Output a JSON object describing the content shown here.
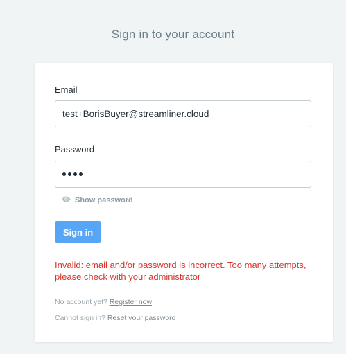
{
  "header": {
    "title": "Sign in to your account"
  },
  "form": {
    "email_label": "Email",
    "email_value": "test+BorisBuyer@streamliner.cloud",
    "password_label": "Password",
    "password_masked_length": 4,
    "show_password_label": "Show password",
    "show_password_icon": "eye-icon",
    "submit_label": "Sign in"
  },
  "error": {
    "message": "Invalid: email and/or password is incorrect. Too many attempts, please check with your administrator"
  },
  "footer": {
    "no_account_text": "No account yet?",
    "register_link": "Register now",
    "cannot_sign_in_text": "Cannot sign in?",
    "reset_link": "Reset your password"
  },
  "colors": {
    "accent": "#56a6f5",
    "error": "#d9352b",
    "background": "#f1f4f5"
  }
}
